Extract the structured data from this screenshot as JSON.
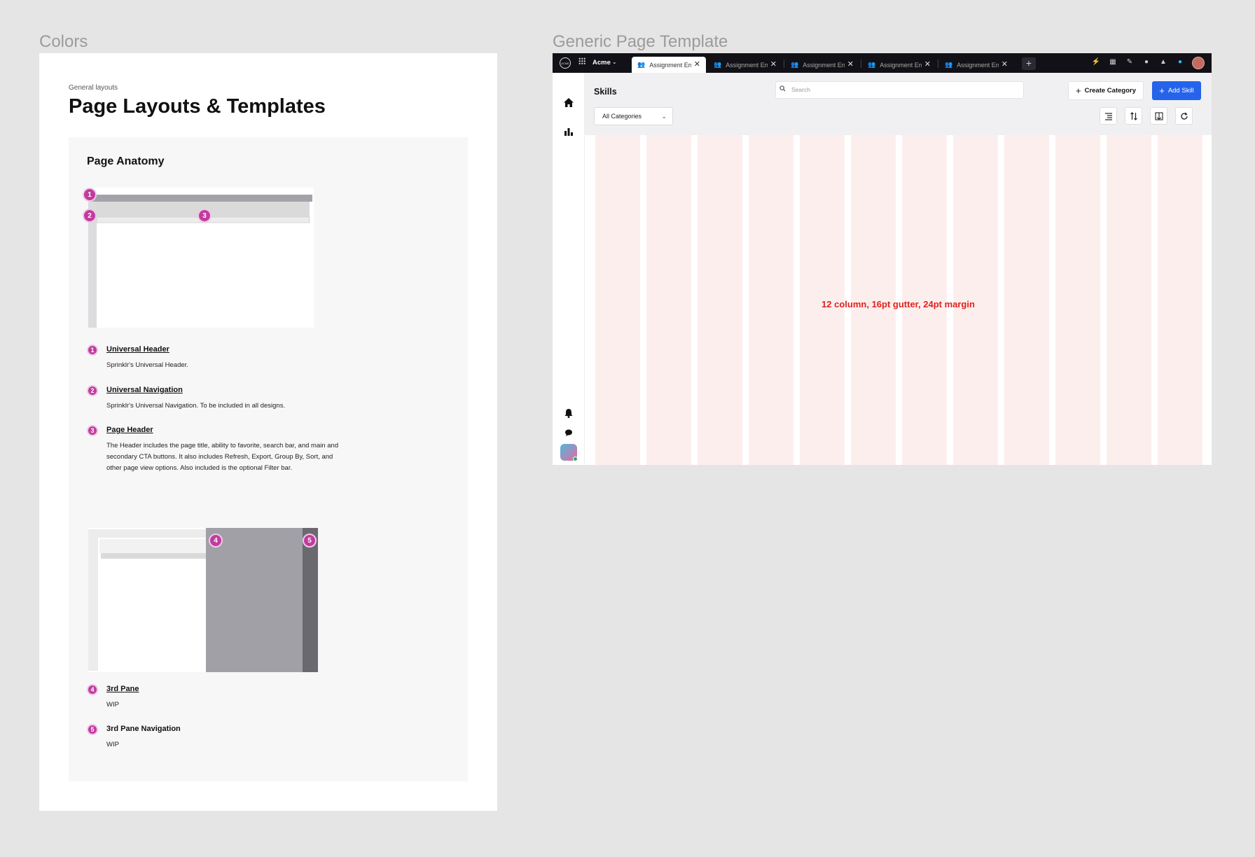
{
  "frames": {
    "left_label": "Colors",
    "right_label": "Generic Page Template"
  },
  "doc": {
    "eyebrow": "General layouts",
    "title": "Page Layouts & Templates",
    "panel_title": "Page Anatomy",
    "items": [
      {
        "num": "1",
        "title": "Universal Header",
        "body": "Sprinklr's Universal Header."
      },
      {
        "num": "2",
        "title": "Universal Navigation",
        "body": "Sprinklr's Universal Navigation. To be included in all designs."
      },
      {
        "num": "3",
        "title": "Page Header",
        "body": "The Header includes the page title, ability to favorite, search bar, and main and secondary CTA buttons. It also includes Refresh, Export, Group By, Sort, and other page view options. Also included is the optional Filter bar."
      },
      {
        "num": "4",
        "title": "3rd Pane",
        "body": "WIP"
      },
      {
        "num": "5",
        "title": "3rd Pane Navigation",
        "body": "WIP"
      }
    ],
    "badge_color": "#c13c9f"
  },
  "template": {
    "topbar": {
      "logo_text": "ACME",
      "workspace": "Acme",
      "tabs": [
        {
          "label": "Assignment Engine",
          "active": true
        },
        {
          "label": "Assignment Engine",
          "active": false
        },
        {
          "label": "Assignment Engine",
          "active": false
        },
        {
          "label": "Assignment Engine",
          "active": false
        },
        {
          "label": "Assignment Engine",
          "active": false
        }
      ],
      "add_tab": "+",
      "icons": [
        "bolt-icon",
        "calendar-icon",
        "pencil-icon",
        "help-icon",
        "bell-icon",
        "chat-icon"
      ]
    },
    "page_header": {
      "title": "Skills",
      "search_placeholder": "Search",
      "create_label": "Create Category",
      "add_label": "Add Skill",
      "filter_value": "All Categories"
    },
    "grid_note": "12 column, 16pt gutter, 24pt margin",
    "colors": {
      "primary": "#2563eb",
      "grid_column": "#fdeeee",
      "grid_note": "#e0231c",
      "topbar": "#111117"
    }
  }
}
